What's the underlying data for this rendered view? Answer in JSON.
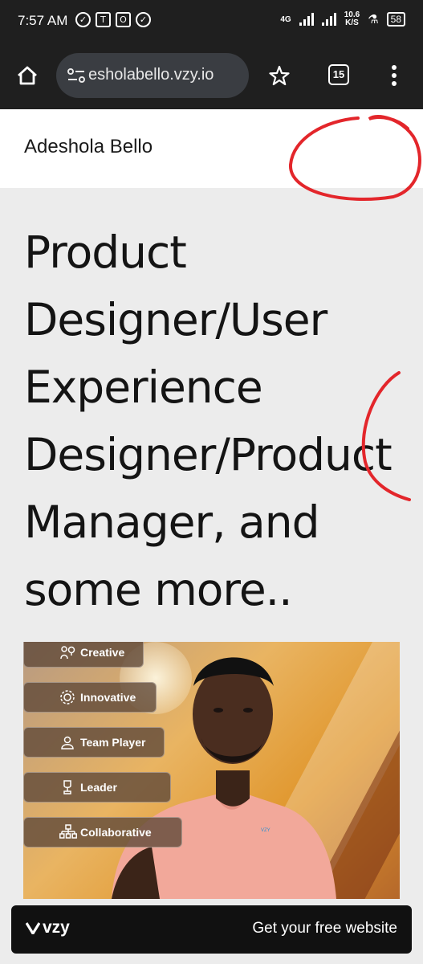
{
  "status_bar": {
    "time": "7:57 AM",
    "network_label": "4G",
    "speed_value": "10.6",
    "speed_unit": "K/S",
    "battery": "58"
  },
  "browser": {
    "url": "esholabello.vzy.io",
    "tab_count": "15"
  },
  "site": {
    "name": "Adeshola Bello",
    "hero_title": "Product\nDesigner/User\nExperience\nDesigner/Product\nManager, and\nsome more.."
  },
  "hero_tags": [
    {
      "label": "Creative",
      "icon": "lightbulb-person-icon"
    },
    {
      "label": "Innovative",
      "icon": "gear-icon"
    },
    {
      "label": "Team Player",
      "icon": "team-icon"
    },
    {
      "label": "Leader",
      "icon": "trophy-icon"
    },
    {
      "label": "Collaborative",
      "icon": "org-chart-icon"
    }
  ],
  "shirt_print": "VZY",
  "banner": {
    "logo": "vzy",
    "cta": "Get your free website"
  },
  "colors": {
    "chrome_bg": "#1f1f1f",
    "url_pill": "#3a3d42",
    "page_bg": "#ececec",
    "annotation_red": "#e3262b",
    "shirt": "#f2a89a"
  }
}
